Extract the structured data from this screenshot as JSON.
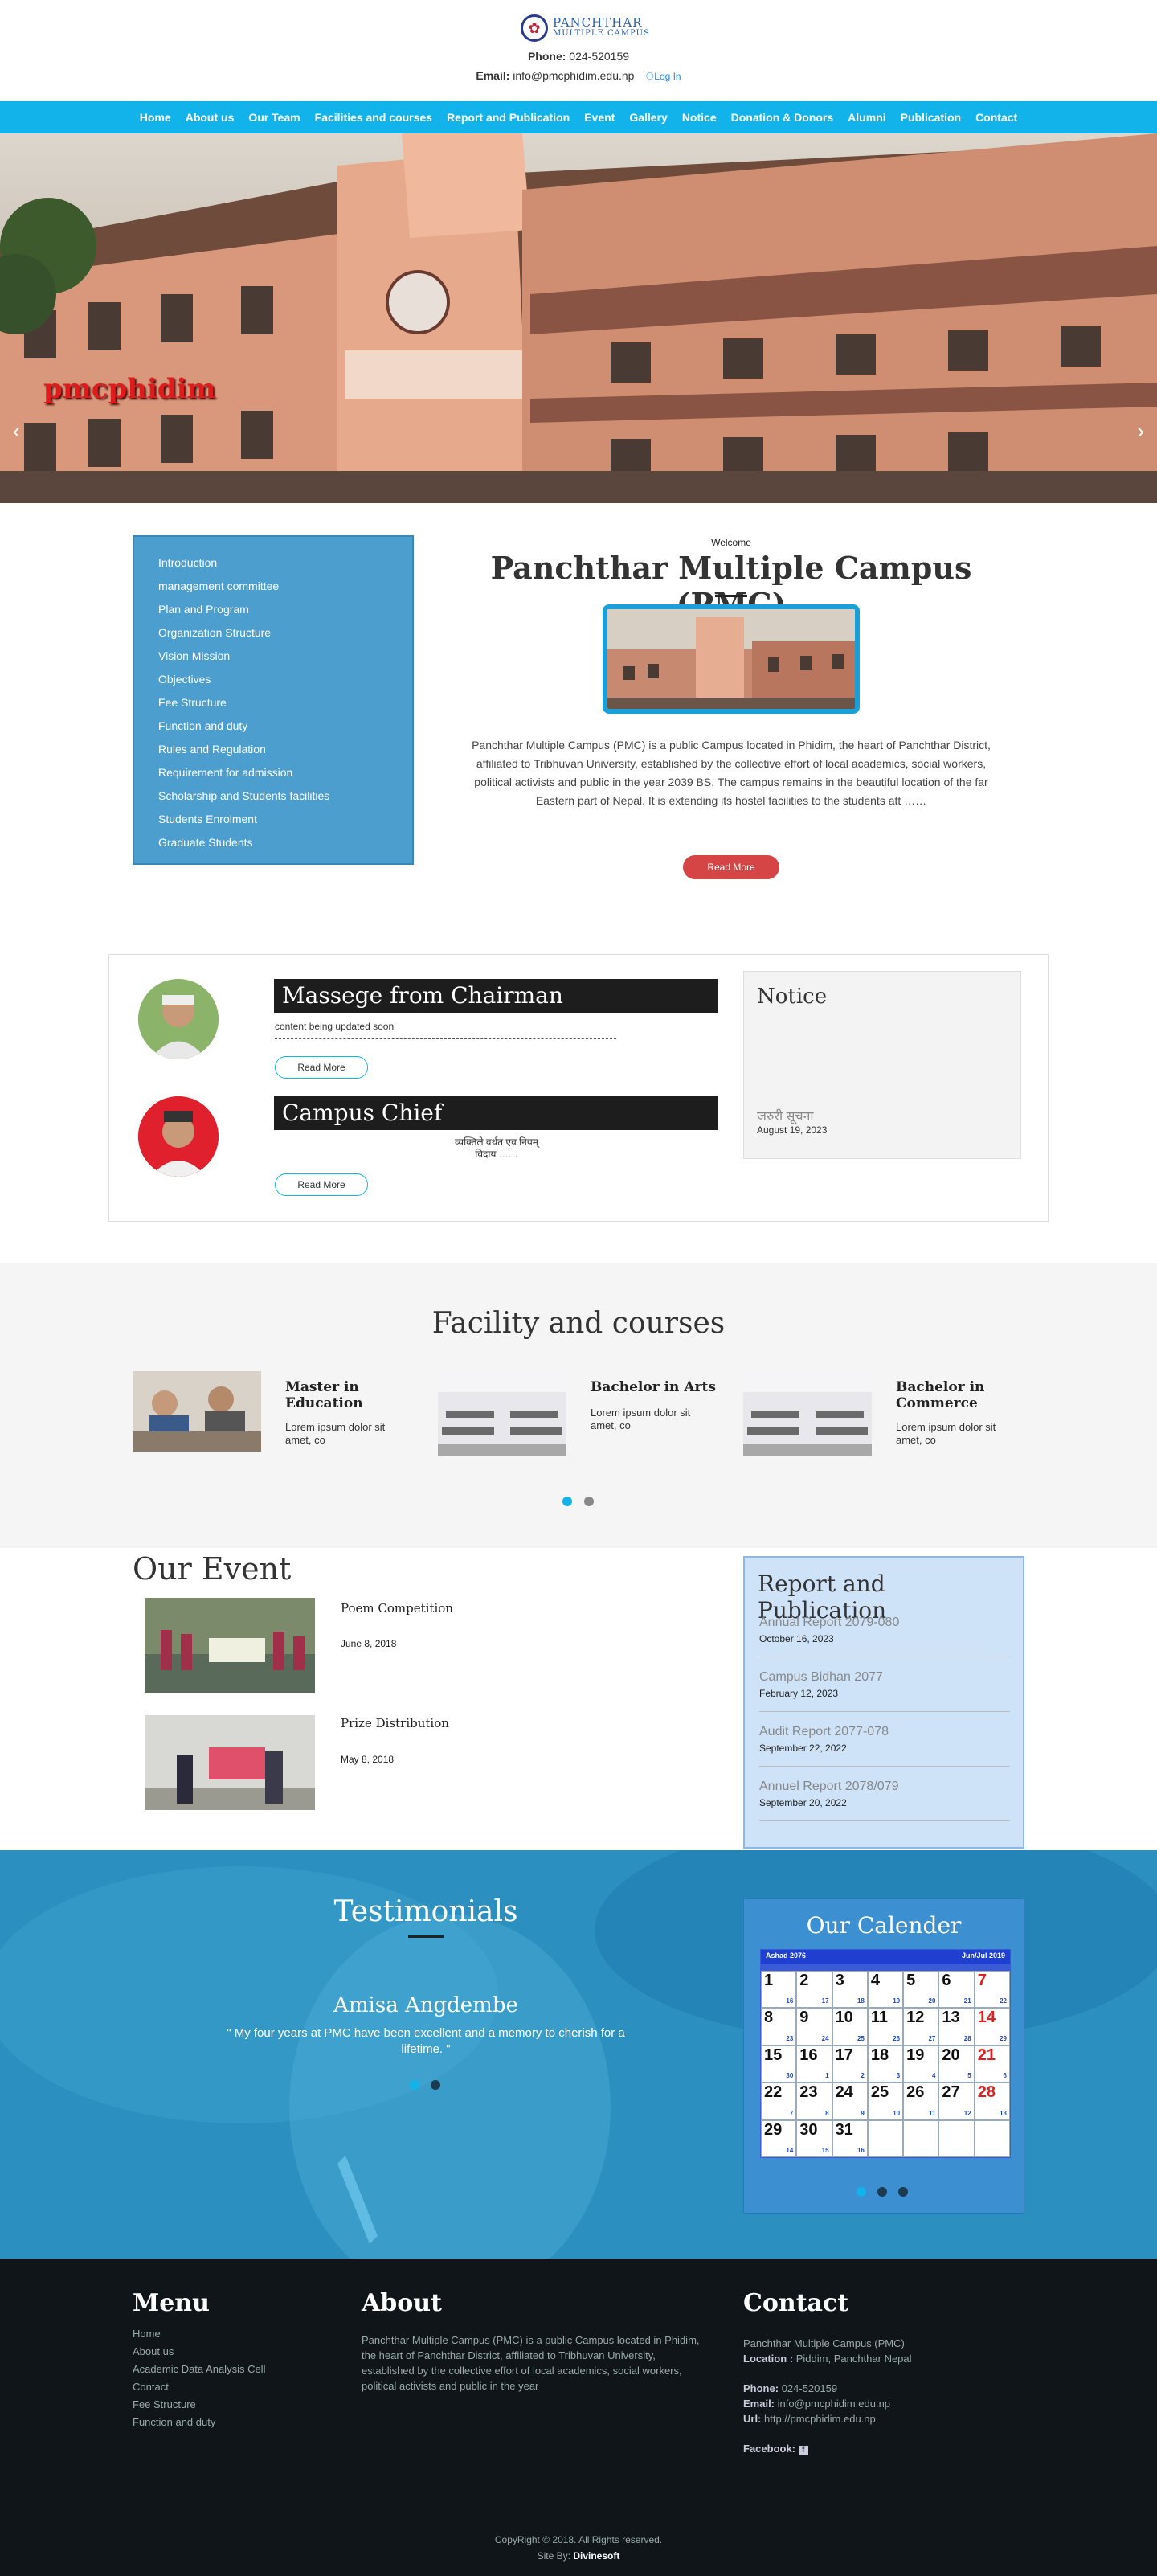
{
  "header": {
    "logo_line1": "PANCHTHAR",
    "logo_line2": "MULTIPLE CAMPUS",
    "phone_label": "Phone:",
    "phone": "024-520159",
    "email_label": "Email:",
    "email": "info@pmcphidim.edu.np",
    "login": "Log In"
  },
  "nav": [
    "Home",
    "About us",
    "Our Team",
    "Facilities and courses",
    "Report and Publication",
    "Event",
    "Gallery",
    "Notice",
    "Donation & Donors",
    "Alumni",
    "Publication",
    "Contact"
  ],
  "hero": {
    "caption": "pmcphidim"
  },
  "sidebar": {
    "items": [
      "Introduction",
      "management committee",
      "Plan and Program",
      "Organization Structure",
      "Vision Mission",
      "Objectives",
      "Fee Structure",
      "Function and duty",
      "Rules and Regulation",
      "Requirement for admission",
      "Scholarship and Students facilities",
      "Students Enrolment",
      "Graduate Students"
    ]
  },
  "welcome": {
    "label": "Welcome",
    "title": "Panchthar Multiple Campus (PMC)",
    "text": "Panchthar Multiple Campus (PMC) is a public Campus located in Phidim, the heart of Panchthar District, affiliated to Tribhuvan University, established by the collective effort of local academics, social workers, political activists and public in the year 2039 BS. The campus remains in the beautiful location of the far Eastern part of Nepal. It is extending its hostel facilities to the students att ……",
    "read_more": "Read More"
  },
  "messages": {
    "chairman_title": "Massege from Chairman",
    "chairman_text": "content being updated soon",
    "chief_title": "Campus Chief",
    "chief_text_1": "व्यक्तिले वर्थत एव नियम्",
    "chief_text_2": "विदाय ……",
    "read_more": "Read More"
  },
  "notice": {
    "title": "Notice",
    "item": "जरुरी सूचना",
    "date": "August 19, 2023"
  },
  "facility": {
    "title": "Facility and courses",
    "items": [
      {
        "name": "Master in Education",
        "desc": "Lorem ipsum dolor sit amet, co"
      },
      {
        "name": "Bachelor in Arts",
        "desc": "Lorem ipsum dolor sit amet, co"
      },
      {
        "name": "Bachelor in Commerce",
        "desc": "Lorem ipsum dolor sit amet, co"
      }
    ]
  },
  "events": {
    "title": "Our Event",
    "items": [
      {
        "name": "Poem Competition",
        "date": "June 8, 2018"
      },
      {
        "name": "Prize Distribution",
        "date": "May 8, 2018"
      }
    ]
  },
  "report": {
    "title": "Report and Publication",
    "items": [
      {
        "name": "Annual Report 2079-080",
        "date": "October 16, 2023"
      },
      {
        "name": "Campus Bidhan 2077",
        "date": "February 12, 2023"
      },
      {
        "name": "Audit Report 2077-078",
        "date": "September 22, 2022"
      },
      {
        "name": "Annuel Report 2078/079",
        "date": "September 20, 2022"
      }
    ]
  },
  "testimonials": {
    "title": "Testimonials",
    "name": "Amisa Angdembe",
    "quote": "\" My four years at PMC    have been excellent and a memory to cherish for a lifetime. \""
  },
  "calendar": {
    "title": "Our Calender",
    "month_np": "Ashad 2076",
    "month_en": "Jun/Jul 2019",
    "days": [
      1,
      2,
      3,
      4,
      5,
      6,
      7,
      8,
      9,
      10,
      11,
      12,
      13,
      14,
      15,
      16,
      17,
      18,
      19,
      20,
      21,
      22,
      23,
      24,
      25,
      26,
      27,
      28,
      29,
      30,
      31
    ],
    "sub": [
      "16",
      "17",
      "18",
      "19",
      "20",
      "21",
      "22",
      "23",
      "24",
      "25",
      "26",
      "27",
      "28",
      "29",
      "30",
      "1",
      "2",
      "3",
      "4",
      "5",
      "6",
      "7",
      "8",
      "9",
      "10",
      "11",
      "12",
      "13",
      "14",
      "15",
      "16"
    ]
  },
  "footer": {
    "menu_title": "Menu",
    "menu": [
      "Home",
      "About us",
      "Academic Data Analysis Cell",
      "Contact",
      "Fee Structure",
      "Function and duty"
    ],
    "about_title": "About",
    "about_text": "Panchthar Multiple Campus (PMC) is a public Campus located in     Phidim, the heart of Panchthar District, affiliated to Tribhuvan    University, established by the collective effort of local academics, social  workers, political activists and public in the year",
    "contact_title": "Contact",
    "contact_name": "Panchthar Multiple Campus (PMC)",
    "location_label": "Location :",
    "location": "Piddim, Panchthar Nepal",
    "phone_label": "Phone:",
    "phone": "024-520159",
    "email_label": "Email:",
    "email": "info@pmcphidim.edu.np",
    "url_label": "Url:",
    "url": "http://pmcphidim.edu.np",
    "facebook_label": "Facebook:",
    "copyright": "CopyRight © 2018. All Rights reserved.",
    "site_by_label": "Site By:",
    "site_by": "Divinesoft"
  },
  "colors": {
    "nav": "#12b3ea",
    "sidebar": "#4c9ecf",
    "accent_red": "#d64545",
    "footer": "#0f1519"
  }
}
